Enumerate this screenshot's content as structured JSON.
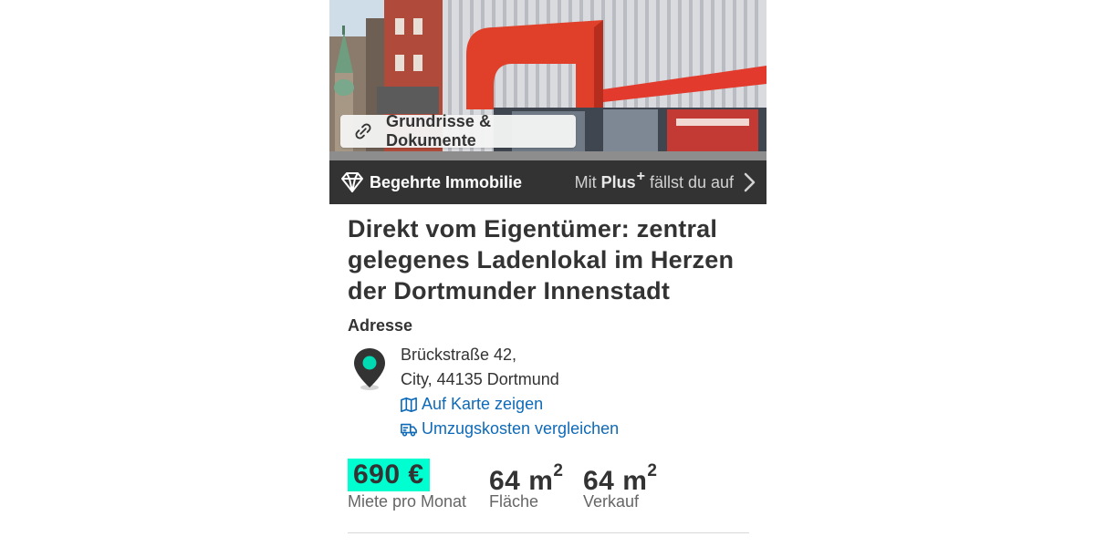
{
  "listing": {
    "photo_alt": "",
    "documents_chip": {
      "label": "Grundrisse & Dokumente",
      "icon": "paperclip-icon"
    },
    "premium_bar": {
      "label": "Begehrte Immobilie",
      "icon": "diamond-icon",
      "promo_prefix": "Mit",
      "promo_plus": "Plus",
      "promo_plus_sup": "+",
      "promo_suffix": "fällst du auf",
      "promo_icon": "chevron-right-icon"
    },
    "title": "Direkt vom Eigentümer: zentral gelegenes Ladenlokal im Herzen der Dortmunder Innenstadt",
    "address": {
      "heading": "Adresse",
      "line1": "Brückstraße 42,",
      "line2": "City, 44135 Dortmund",
      "map_link": "Auf Karte zeigen",
      "moving_link": "Umzugskosten vergleichen",
      "pin_icon": "location-pin-icon",
      "map_icon": "map-icon",
      "moving_icon": "truck-icon"
    },
    "key_facts": {
      "price_value": "690 €",
      "price_label": "Miete pro Monat",
      "area_value": "64 m",
      "area_unit_sup": "2",
      "area_label": "Fläche",
      "sales_area_value": "64 m",
      "sales_area_unit_sup": "2",
      "sales_area_label": "Verkauf"
    }
  },
  "colors": {
    "premium_bar_bg": "#333333",
    "price_highlight": "#00ffd0",
    "link": "#0e6ab8",
    "pin_dot": "#00d9b1",
    "text": "#333333"
  }
}
